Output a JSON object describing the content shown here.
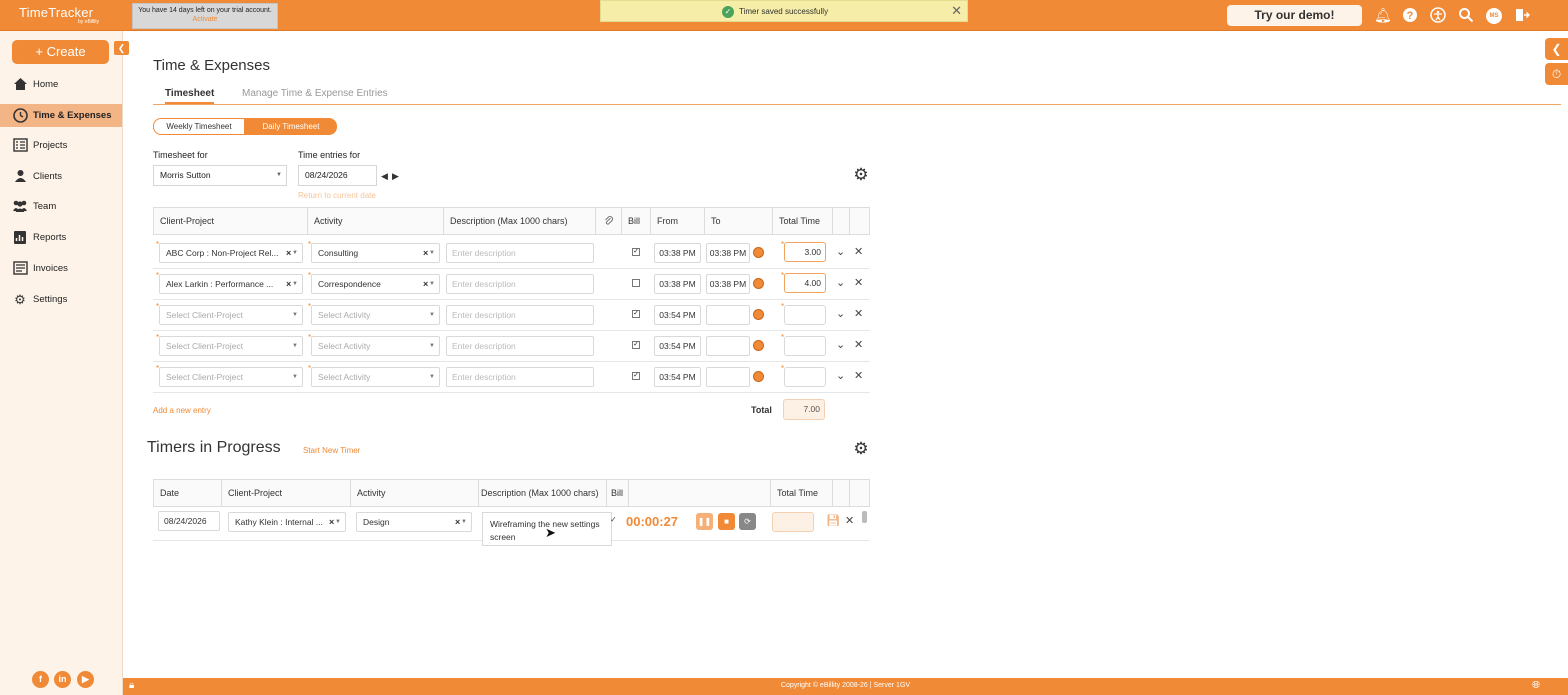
{
  "app": {
    "logo": "TimeTracker",
    "logo_sub": "by eBillity"
  },
  "trial": {
    "text": "You have 14 days left on your trial account.",
    "link": "Activate"
  },
  "toast": {
    "text": "Timer saved successfully"
  },
  "topbar": {
    "demo_label": "Try our demo!",
    "avatar": "MS",
    "icons": [
      "bell-icon",
      "help-icon",
      "accessibility-icon",
      "search-icon",
      "avatar",
      "logout-icon"
    ]
  },
  "sidebar": {
    "create_label": "+ Create",
    "items": [
      {
        "label": "Home",
        "icon": "home-icon"
      },
      {
        "label": "Time & Expenses",
        "icon": "clock-icon"
      },
      {
        "label": "Projects",
        "icon": "projects-icon"
      },
      {
        "label": "Clients",
        "icon": "clients-icon"
      },
      {
        "label": "Team",
        "icon": "team-icon"
      },
      {
        "label": "Reports",
        "icon": "reports-icon"
      },
      {
        "label": "Invoices",
        "icon": "invoices-icon"
      },
      {
        "label": "Settings",
        "icon": "gear-icon"
      }
    ],
    "social": [
      "f",
      "in",
      "▶"
    ]
  },
  "page": {
    "title": "Time & Expenses",
    "tabs": [
      "Timesheet",
      "Manage Time & Expense Entries"
    ],
    "segments": [
      "Weekly Timesheet",
      "Daily Timesheet"
    ],
    "timesheet_for_label": "Timesheet for",
    "timesheet_for_value": "Morris Sutton",
    "time_entries_label": "Time entries for",
    "date_value": "08/24/2026",
    "return_link": "Return to current date"
  },
  "table": {
    "headers": [
      "Client-Project",
      "Activity",
      "Description (Max 1000 chars)",
      "",
      "Bill",
      "From",
      "To",
      "Total Time"
    ],
    "rows": [
      {
        "client": "ABC Corp : Non-Project Rel...",
        "activity": "Consulting",
        "desc": "Enter description",
        "bill": true,
        "from": "03:38 PM",
        "to": "03:38 PM",
        "total": "3.00"
      },
      {
        "client": "Alex Larkin : Performance ...",
        "activity": "Correspondence",
        "desc": "Enter description",
        "bill": false,
        "from": "03:38 PM",
        "to": "03:38 PM",
        "total": "4.00"
      },
      {
        "client": "Select Client-Project",
        "activity": "Select Activity",
        "desc": "Enter description",
        "bill": true,
        "from": "03:54 PM",
        "to": "",
        "total": ""
      },
      {
        "client": "Select Client-Project",
        "activity": "Select Activity",
        "desc": "Enter description",
        "bill": true,
        "from": "03:54 PM",
        "to": "",
        "total": ""
      },
      {
        "client": "Select Client-Project",
        "activity": "Select Activity",
        "desc": "Enter description",
        "bill": true,
        "from": "03:54 PM",
        "to": "",
        "total": ""
      }
    ],
    "add_entry": "Add a new entry",
    "total_label": "Total",
    "total_value": "7.00"
  },
  "timers": {
    "title": "Timers in Progress",
    "start_link": "Start New Timer",
    "headers": [
      "Date",
      "Client-Project",
      "Activity",
      "Description (Max 1000 chars)",
      "Bill",
      "",
      "Total Time"
    ],
    "row": {
      "date": "08/24/2026",
      "client": "Kathy Klein : Internal ...",
      "activity": "Design",
      "desc": "Wireframing the new settings screen",
      "elapsed": "00:00:27"
    }
  },
  "footer": {
    "text": "Copyright © eBillity 2008-26 | Server 1GV"
  }
}
